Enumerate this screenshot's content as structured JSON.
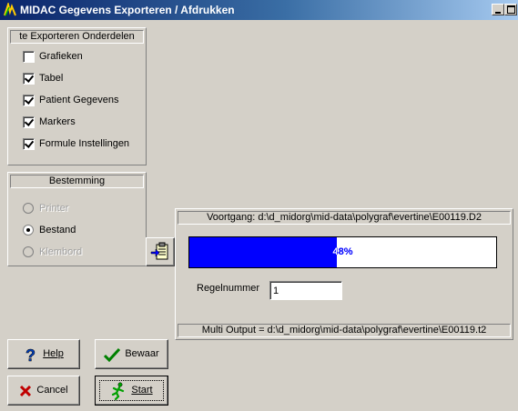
{
  "window": {
    "title": "MIDAC  Gegevens Exporteren / Afdrukken"
  },
  "export_parts": {
    "header": "te Exporteren Onderdelen",
    "items": [
      {
        "label": "Grafieken",
        "checked": false
      },
      {
        "label": "Tabel",
        "checked": true
      },
      {
        "label": "Patient Gegevens",
        "checked": true
      },
      {
        "label": "Markers",
        "checked": true
      },
      {
        "label": "Formule Instellingen",
        "checked": true
      }
    ]
  },
  "destination": {
    "header": "Bestemming",
    "options": [
      {
        "label": "Printer",
        "selected": false,
        "enabled": false
      },
      {
        "label": "Bestand",
        "selected": true,
        "enabled": true
      },
      {
        "label": "Klembord",
        "selected": false,
        "enabled": false
      }
    ]
  },
  "progress": {
    "header": "Voortgang: d:\\d_midorg\\mid-data\\polygraf\\evertine\\E00119.D2",
    "percent": 48,
    "percent_label": "48%",
    "line_number_label": "Regelnummer",
    "line_number_value": "1",
    "footer": "Multi Output = d:\\d_midorg\\mid-data\\polygraf\\evertine\\E00119.t2"
  },
  "buttons": {
    "help": "Help",
    "save": "Bewaar",
    "cancel": "Cancel",
    "start": "Start"
  },
  "icons": {
    "app": "midac-app-icon",
    "clipboard": "clipboard-arrow-icon",
    "help": "question-mark-icon",
    "save": "green-check-icon",
    "cancel": "red-x-icon",
    "start": "running-man-icon"
  },
  "colors": {
    "progress_fill": "#0000ff",
    "titlebar_start": "#0a246a",
    "titlebar_end": "#a6caf0"
  }
}
